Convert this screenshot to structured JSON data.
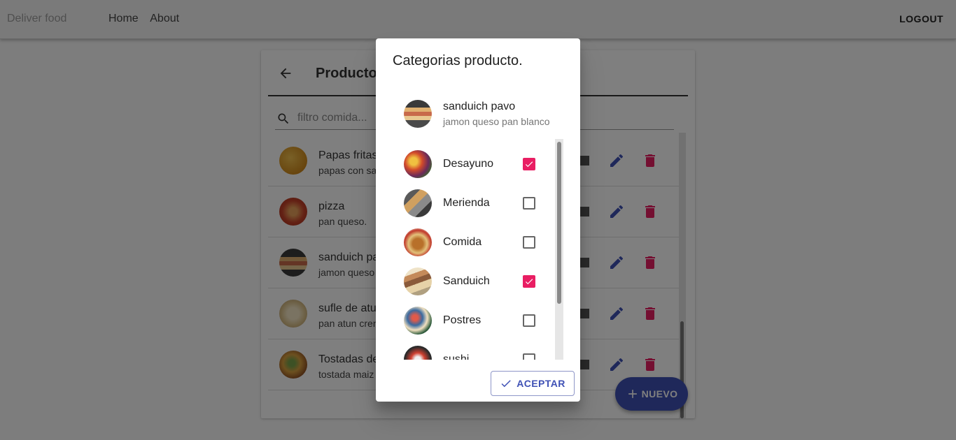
{
  "appbar": {
    "brand": "Deliver food",
    "nav": [
      "Home",
      "About"
    ],
    "logout": "LOGOUT"
  },
  "card": {
    "title": "Producto",
    "search_placeholder": "filtro comida...",
    "products": [
      {
        "name": "Papas fritas",
        "desc": "papas con sa"
      },
      {
        "name": "pizza",
        "desc": "pan queso."
      },
      {
        "name": "sanduich pa",
        "desc": "jamon queso"
      },
      {
        "name": "sufle de atu",
        "desc": "pan atun cren"
      },
      {
        "name": "Tostadas de",
        "desc": "tostada maiz"
      }
    ],
    "fab_label": "NUEVO"
  },
  "dialog": {
    "title": "Categorias producto.",
    "product": {
      "name": "sanduich pavo",
      "desc": "jamon queso pan blanco"
    },
    "categories": [
      {
        "name": "Desayuno",
        "checked": true
      },
      {
        "name": "Merienda",
        "checked": false
      },
      {
        "name": "Comida",
        "checked": false
      },
      {
        "name": "Sanduich",
        "checked": true
      },
      {
        "name": "Postres",
        "checked": false
      },
      {
        "name": "sushi",
        "checked": false
      }
    ],
    "accept_label": "ACEPTAR"
  },
  "colors": {
    "primary": "#3f51b5",
    "accent": "#e91e63"
  }
}
